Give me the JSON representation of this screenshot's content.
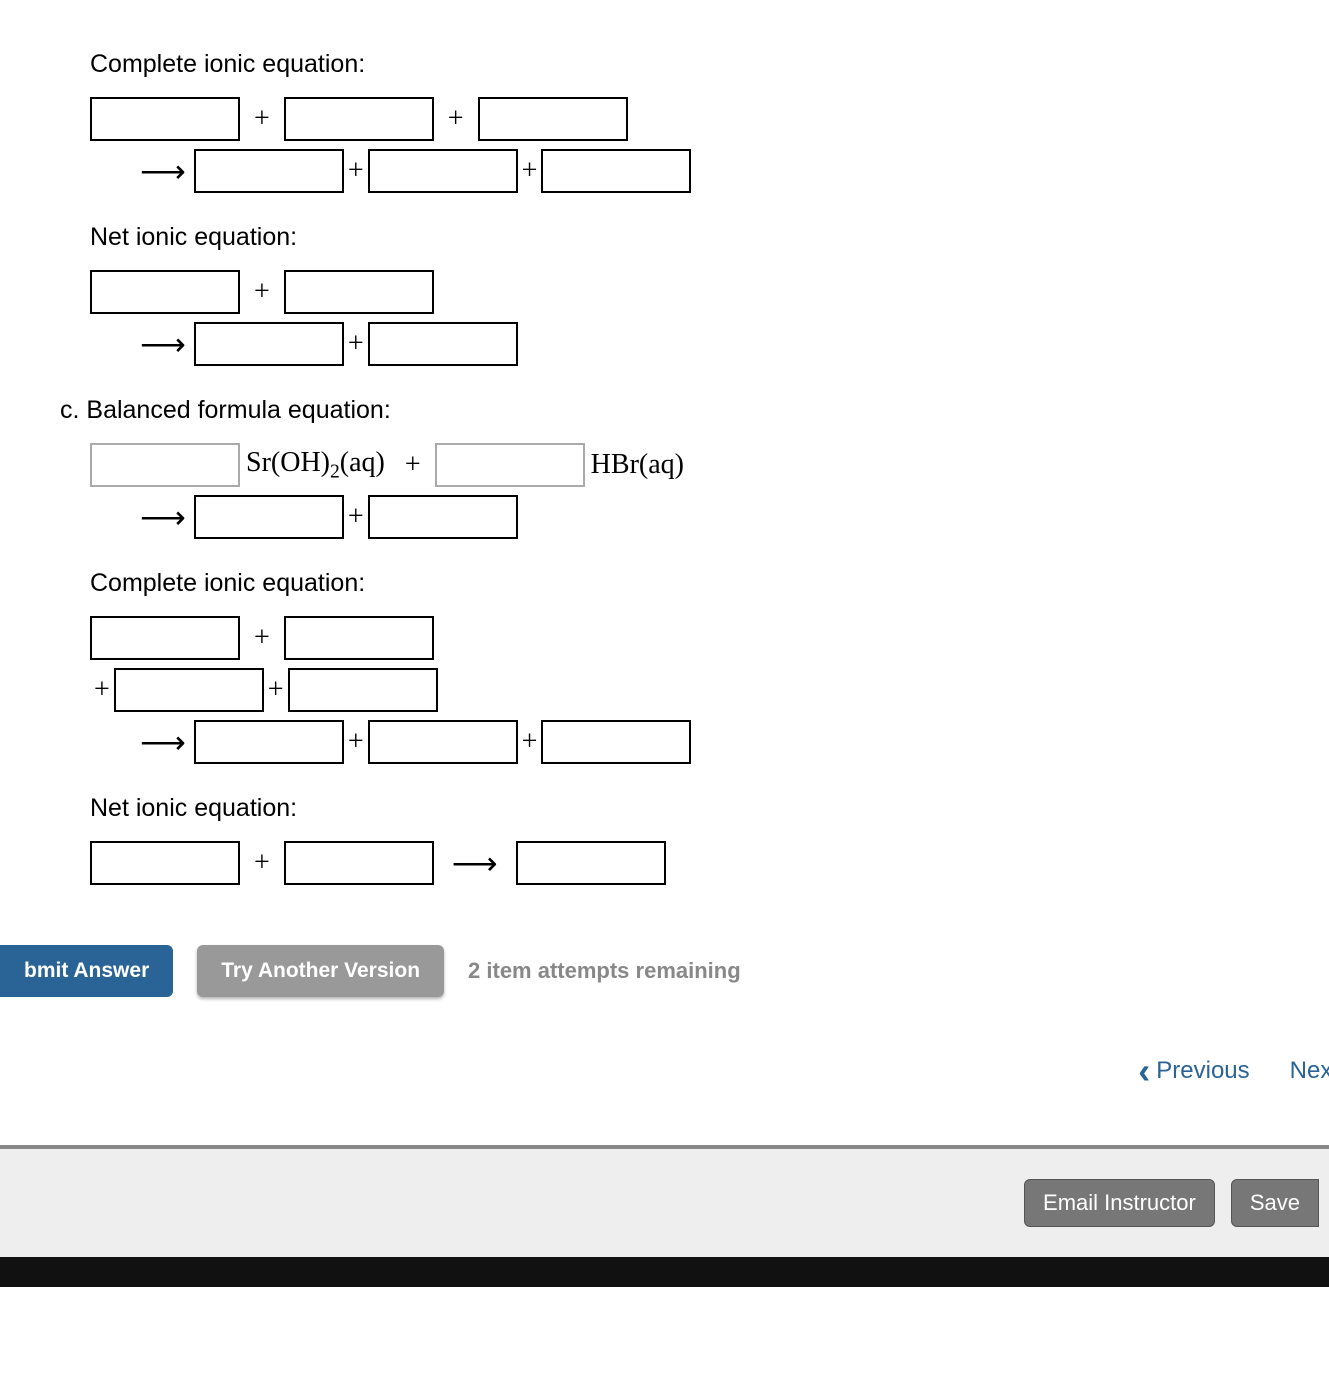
{
  "sections": {
    "complete_ionic_1": "Complete ionic equation:",
    "net_ionic_1": "Net ionic equation:",
    "part_c": "c. Balanced formula equation:",
    "complete_ionic_2": "Complete ionic equation:",
    "net_ionic_2": "Net ionic equation:"
  },
  "symbols": {
    "plus": "+",
    "arrow": "⟶"
  },
  "partc": {
    "reactant1": "Sr(OH)",
    "reactant1_sub": "2",
    "reactant1_state": "(aq)",
    "reactant2": "HBr(aq)"
  },
  "buttons": {
    "submit": "bmit Answer",
    "try_another": "Try Another Version",
    "attempts": "2 item attempts remaining",
    "previous": "Previous",
    "next": "Next",
    "email": "Email Instructor",
    "save": "Save"
  }
}
